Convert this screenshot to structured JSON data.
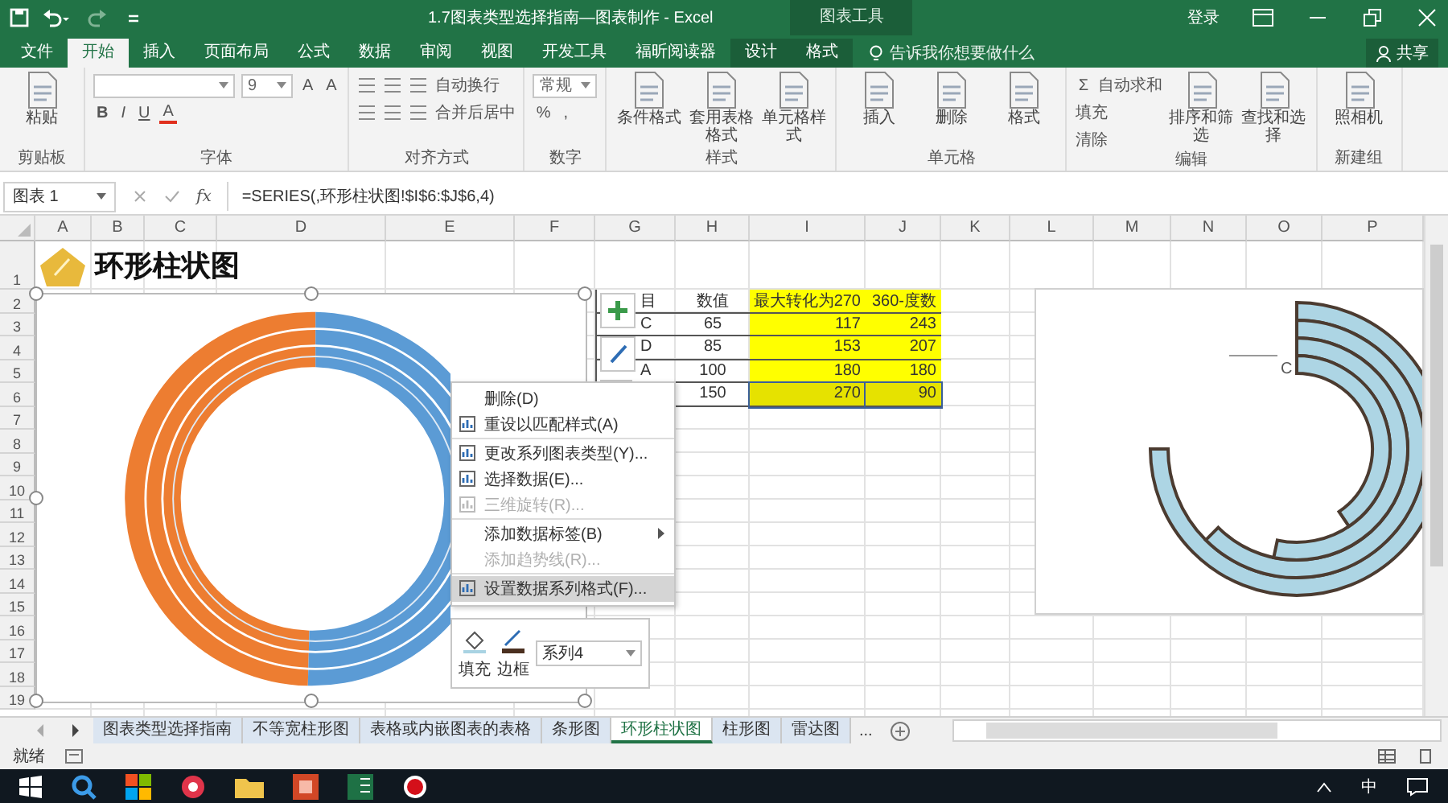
{
  "title_bar": {
    "title": "1.7图表类型选择指南—图表制作 - Excel",
    "context_label": "图表工具",
    "account": "登录"
  },
  "ribbon_tabs": [
    {
      "label": "文件",
      "selected": false,
      "contextual": false
    },
    {
      "label": "开始",
      "selected": true,
      "contextual": false
    },
    {
      "label": "插入",
      "selected": false,
      "contextual": false
    },
    {
      "label": "页面布局",
      "selected": false,
      "contextual": false
    },
    {
      "label": "公式",
      "selected": false,
      "contextual": false
    },
    {
      "label": "数据",
      "selected": false,
      "contextual": false
    },
    {
      "label": "审阅",
      "selected": false,
      "contextual": false
    },
    {
      "label": "视图",
      "selected": false,
      "contextual": false
    },
    {
      "label": "开发工具",
      "selected": false,
      "contextual": false
    },
    {
      "label": "福昕阅读器",
      "selected": false,
      "contextual": false
    },
    {
      "label": "设计",
      "selected": false,
      "contextual": true
    },
    {
      "label": "格式",
      "selected": false,
      "contextual": true
    }
  ],
  "tell_me": {
    "placeholder": "告诉我你想要做什么"
  },
  "share": "共享",
  "ribbon_groups": [
    {
      "label": "剪贴板",
      "items": [
        {
          "kind": "large",
          "label": "粘贴"
        }
      ]
    },
    {
      "label": "字体",
      "items": [
        {
          "kind": "stack",
          "rows": [
            [
              {
                "kind": "field"
              },
              {
                "kind": "field",
                "value": "9"
              },
              {
                "kind": "glyph",
                "text": "A"
              },
              {
                "kind": "glyph",
                "text": "A"
              }
            ],
            [
              {
                "kind": "bold",
                "text": "B"
              },
              {
                "kind": "italic",
                "text": "I"
              },
              {
                "kind": "underline",
                "text": "U"
              },
              {
                "kind": "color",
                "text": "A"
              }
            ]
          ]
        }
      ]
    },
    {
      "label": "对齐方式",
      "items": [
        {
          "kind": "stack",
          "rows": [
            [
              {
                "kind": "lines"
              },
              {
                "kind": "lines"
              },
              {
                "kind": "lines"
              },
              {
                "kind": "small",
                "label": "自动换行"
              }
            ],
            [
              {
                "kind": "lines"
              },
              {
                "kind": "lines"
              },
              {
                "kind": "lines"
              },
              {
                "kind": "small",
                "label": "合并后居中"
              }
            ]
          ]
        }
      ]
    },
    {
      "label": "数字",
      "items": [
        {
          "kind": "stack",
          "rows": [
            [
              {
                "kind": "field",
                "value": "常规"
              }
            ],
            [
              {
                "kind": "glyph",
                "text": "%"
              },
              {
                "kind": "glyph",
                "text": ","
              }
            ]
          ]
        }
      ]
    },
    {
      "label": "样式",
      "items": [
        {
          "kind": "large",
          "label": "条件格式"
        },
        {
          "kind": "large",
          "label": "套用表格格式"
        },
        {
          "kind": "large",
          "label": "单元格样式"
        }
      ]
    },
    {
      "label": "单元格",
      "items": [
        {
          "kind": "large",
          "label": "插入"
        },
        {
          "kind": "large",
          "label": "删除"
        },
        {
          "kind": "large",
          "label": "格式"
        }
      ]
    },
    {
      "label": "编辑",
      "items": [
        {
          "kind": "stack",
          "rows": [
            [
              {
                "kind": "glyph",
                "text": "Σ"
              },
              {
                "kind": "small",
                "label": "自动求和"
              }
            ],
            [
              {
                "kind": "small",
                "label": "填充"
              }
            ],
            [
              {
                "kind": "small",
                "label": "清除"
              }
            ]
          ]
        },
        {
          "kind": "large",
          "label": "排序和筛选"
        },
        {
          "kind": "large",
          "label": "查找和选择"
        }
      ]
    },
    {
      "label": "新建组",
      "items": [
        {
          "kind": "large",
          "label": "照相机"
        }
      ]
    }
  ],
  "formula_bar": {
    "name_box": "图表 1",
    "fx": "fx",
    "formula": "=SERIES(,环形柱状图!$I$6:$J$6,4)"
  },
  "sheet": {
    "columns": [
      "A",
      "B",
      "C",
      "D",
      "E",
      "F",
      "G",
      "H",
      "I",
      "J",
      "K",
      "L",
      "M",
      "N",
      "O",
      "P"
    ],
    "rows": [
      "1",
      "2",
      "3",
      "4",
      "5",
      "6",
      "7",
      "8",
      "9",
      "10",
      "11",
      "12",
      "13",
      "14",
      "15",
      "16",
      "17",
      "18",
      "19"
    ],
    "title": "环形柱状图",
    "table": [
      {
        "selected": false,
        "cells": [
          {
            "text": "目",
            "highlighted": false
          },
          {
            "text": "数值",
            "highlighted": false
          },
          {
            "text": "最大转化为270",
            "highlighted": true
          },
          {
            "text": "360-度数",
            "highlighted": true
          }
        ]
      },
      {
        "selected": false,
        "cells": [
          {
            "text": "C",
            "highlighted": false
          },
          {
            "text": "65",
            "highlighted": false
          },
          {
            "text": "117",
            "highlighted": true
          },
          {
            "text": "243",
            "highlighted": true
          }
        ]
      },
      {
        "selected": false,
        "cells": [
          {
            "text": "D",
            "highlighted": false
          },
          {
            "text": "85",
            "highlighted": false
          },
          {
            "text": "153",
            "highlighted": true
          },
          {
            "text": "207",
            "highlighted": true
          }
        ]
      },
      {
        "selected": false,
        "cells": [
          {
            "text": "A",
            "highlighted": false
          },
          {
            "text": "100",
            "highlighted": false
          },
          {
            "text": "180",
            "highlighted": true
          },
          {
            "text": "180",
            "highlighted": true
          }
        ]
      },
      {
        "selected": true,
        "cells": [
          {
            "text": "150",
            "highlighted": false
          },
          {
            "text": "270",
            "highlighted": true
          },
          {
            "text": "90",
            "highlighted": true
          }
        ]
      }
    ]
  },
  "right_chart": {
    "label": "C"
  },
  "context_menu": [
    {
      "label": "删除(D)",
      "icon": false,
      "disabled": false,
      "highlighted": false,
      "submenu": false,
      "separator_after": false
    },
    {
      "label": "重设以匹配样式(A)",
      "icon": true,
      "disabled": false,
      "highlighted": false,
      "submenu": false,
      "separator_after": true
    },
    {
      "label": "更改系列图表类型(Y)...",
      "icon": true,
      "disabled": false,
      "highlighted": false,
      "submenu": false,
      "separator_after": false
    },
    {
      "label": "选择数据(E)...",
      "icon": true,
      "disabled": false,
      "highlighted": false,
      "submenu": false,
      "separator_after": false
    },
    {
      "label": "三维旋转(R)...",
      "icon": true,
      "disabled": true,
      "highlighted": false,
      "submenu": false,
      "separator_after": true
    },
    {
      "label": "添加数据标签(B)",
      "icon": false,
      "disabled": false,
      "highlighted": false,
      "submenu": true,
      "separator_after": false
    },
    {
      "label": "添加趋势线(R)...",
      "icon": false,
      "disabled": true,
      "highlighted": false,
      "submenu": false,
      "separator_after": true
    },
    {
      "label": "设置数据系列格式(F)...",
      "icon": true,
      "disabled": false,
      "highlighted": true,
      "submenu": false,
      "separator_after": false
    }
  ],
  "mini_toolbar": {
    "fill": "填充",
    "border": "边框",
    "series": "系列4"
  },
  "sheet_tabs": [
    {
      "label": "图表类型选择指南",
      "selected": false
    },
    {
      "label": "不等宽柱形图",
      "selected": false
    },
    {
      "label": "表格或内嵌图表的表格",
      "selected": false
    },
    {
      "label": "条形图",
      "selected": false
    },
    {
      "label": "环形柱状图",
      "selected": true
    },
    {
      "label": "柱形图",
      "selected": false
    },
    {
      "label": "雷达图",
      "selected": false
    }
  ],
  "more_tabs": "...",
  "status_bar": {
    "text": "就绪"
  },
  "taskbar": {
    "ime": "中"
  }
}
